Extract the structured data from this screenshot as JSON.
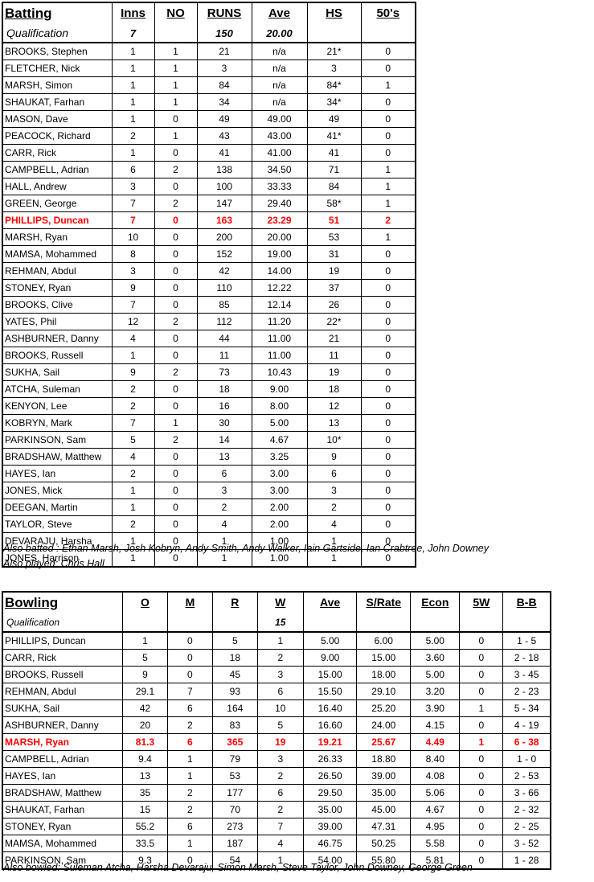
{
  "batting": {
    "title": "Batting",
    "columns": [
      "Inns",
      "NO",
      "RUNS",
      "Ave",
      "HS",
      "50's"
    ],
    "qualification_label": "Qualification",
    "qualification": [
      "7",
      "",
      "150",
      "20.00",
      "",
      ""
    ],
    "rows": [
      {
        "name": "BROOKS, Stephen",
        "inns": "1",
        "no": "1",
        "runs": "21",
        "ave": "n/a",
        "hs": "21*",
        "fifties": "0",
        "highlight": false
      },
      {
        "name": "FLETCHER, Nick",
        "inns": "1",
        "no": "1",
        "runs": "3",
        "ave": "n/a",
        "hs": "3",
        "fifties": "0",
        "highlight": false
      },
      {
        "name": "MARSH, Simon",
        "inns": "1",
        "no": "1",
        "runs": "84",
        "ave": "n/a",
        "hs": "84*",
        "fifties": "1",
        "highlight": false
      },
      {
        "name": "SHAUKAT, Farhan",
        "inns": "1",
        "no": "1",
        "runs": "34",
        "ave": "n/a",
        "hs": "34*",
        "fifties": "0",
        "highlight": false
      },
      {
        "name": "MASON, Dave",
        "inns": "1",
        "no": "0",
        "runs": "49",
        "ave": "49.00",
        "hs": "49",
        "fifties": "0",
        "highlight": false
      },
      {
        "name": "PEACOCK, Richard",
        "inns": "2",
        "no": "1",
        "runs": "43",
        "ave": "43.00",
        "hs": "41*",
        "fifties": "0",
        "highlight": false
      },
      {
        "name": "CARR, Rick",
        "inns": "1",
        "no": "0",
        "runs": "41",
        "ave": "41.00",
        "hs": "41",
        "fifties": "0",
        "highlight": false
      },
      {
        "name": "CAMPBELL, Adrian",
        "inns": "6",
        "no": "2",
        "runs": "138",
        "ave": "34.50",
        "hs": "71",
        "fifties": "1",
        "highlight": false
      },
      {
        "name": "HALL, Andrew",
        "inns": "3",
        "no": "0",
        "runs": "100",
        "ave": "33.33",
        "hs": "84",
        "fifties": "1",
        "highlight": false
      },
      {
        "name": "GREEN, George",
        "inns": "7",
        "no": "2",
        "runs": "147",
        "ave": "29.40",
        "hs": "58*",
        "fifties": "1",
        "highlight": false
      },
      {
        "name": "PHILLIPS, Duncan",
        "inns": "7",
        "no": "0",
        "runs": "163",
        "ave": "23.29",
        "hs": "51",
        "fifties": "2",
        "highlight": true
      },
      {
        "name": "MARSH, Ryan",
        "inns": "10",
        "no": "0",
        "runs": "200",
        "ave": "20.00",
        "hs": "53",
        "fifties": "1",
        "highlight": false
      },
      {
        "name": "MAMSA, Mohammed",
        "inns": "8",
        "no": "0",
        "runs": "152",
        "ave": "19.00",
        "hs": "31",
        "fifties": "0",
        "highlight": false
      },
      {
        "name": "REHMAN, Abdul",
        "inns": "3",
        "no": "0",
        "runs": "42",
        "ave": "14.00",
        "hs": "19",
        "fifties": "0",
        "highlight": false
      },
      {
        "name": "STONEY, Ryan",
        "inns": "9",
        "no": "0",
        "runs": "110",
        "ave": "12.22",
        "hs": "37",
        "fifties": "0",
        "highlight": false
      },
      {
        "name": "BROOKS, Clive",
        "inns": "7",
        "no": "0",
        "runs": "85",
        "ave": "12.14",
        "hs": "26",
        "fifties": "0",
        "highlight": false
      },
      {
        "name": "YATES, Phil",
        "inns": "12",
        "no": "2",
        "runs": "112",
        "ave": "11.20",
        "hs": "22*",
        "fifties": "0",
        "highlight": false
      },
      {
        "name": "ASHBURNER, Danny",
        "inns": "4",
        "no": "0",
        "runs": "44",
        "ave": "11.00",
        "hs": "21",
        "fifties": "0",
        "highlight": false
      },
      {
        "name": "BROOKS, Russell",
        "inns": "1",
        "no": "0",
        "runs": "11",
        "ave": "11.00",
        "hs": "11",
        "fifties": "0",
        "highlight": false
      },
      {
        "name": "SUKHA, Sail",
        "inns": "9",
        "no": "2",
        "runs": "73",
        "ave": "10.43",
        "hs": "19",
        "fifties": "0",
        "highlight": false
      },
      {
        "name": "ATCHA, Suleman",
        "inns": "2",
        "no": "0",
        "runs": "18",
        "ave": "9.00",
        "hs": "18",
        "fifties": "0",
        "highlight": false
      },
      {
        "name": "KENYON, Lee",
        "inns": "2",
        "no": "0",
        "runs": "16",
        "ave": "8.00",
        "hs": "12",
        "fifties": "0",
        "highlight": false
      },
      {
        "name": "KOBRYN, Mark",
        "inns": "7",
        "no": "1",
        "runs": "30",
        "ave": "5.00",
        "hs": "13",
        "fifties": "0",
        "highlight": false
      },
      {
        "name": "PARKINSON, Sam",
        "inns": "5",
        "no": "2",
        "runs": "14",
        "ave": "4.67",
        "hs": "10*",
        "fifties": "0",
        "highlight": false
      },
      {
        "name": "BRADSHAW, Matthew",
        "inns": "4",
        "no": "0",
        "runs": "13",
        "ave": "3.25",
        "hs": "9",
        "fifties": "0",
        "highlight": false
      },
      {
        "name": "HAYES, Ian",
        "inns": "2",
        "no": "0",
        "runs": "6",
        "ave": "3.00",
        "hs": "6",
        "fifties": "0",
        "highlight": false
      },
      {
        "name": "JONES, Mick",
        "inns": "1",
        "no": "0",
        "runs": "3",
        "ave": "3.00",
        "hs": "3",
        "fifties": "0",
        "highlight": false
      },
      {
        "name": "DEEGAN, Martin",
        "inns": "1",
        "no": "0",
        "runs": "2",
        "ave": "2.00",
        "hs": "2",
        "fifties": "0",
        "highlight": false
      },
      {
        "name": "TAYLOR, Steve",
        "inns": "2",
        "no": "0",
        "runs": "4",
        "ave": "2.00",
        "hs": "4",
        "fifties": "0",
        "highlight": false
      },
      {
        "name": "DEVARAJU, Harsha",
        "inns": "1",
        "no": "0",
        "runs": "1",
        "ave": "1.00",
        "hs": "1",
        "fifties": "0",
        "highlight": false
      },
      {
        "name": "JONES, Harrison",
        "inns": "1",
        "no": "0",
        "runs": "1",
        "ave": "1.00",
        "hs": "1",
        "fifties": "0",
        "highlight": false
      }
    ],
    "notes": [
      "Also batted : Ethan Marsh, Josh Kobryn, Andy Smith, Andy Walker, Iain Gartside, Ian Crabtree, John Downey",
      "Also played: Chris Hall"
    ]
  },
  "bowling": {
    "title": "Bowling",
    "columns": [
      "O",
      "M",
      "R",
      "W",
      "Ave",
      "S/Rate",
      "Econ",
      "5W",
      "B-B"
    ],
    "qualification_label": "Qualification",
    "qualification": [
      "",
      "",
      "",
      "15",
      "",
      "",
      "",
      "",
      ""
    ],
    "rows": [
      {
        "name": "PHILLIPS, Duncan",
        "o": "1",
        "m": "0",
        "r": "5",
        "w": "1",
        "ave": "5.00",
        "srate": "6.00",
        "econ": "5.00",
        "fivew": "0",
        "bb": "1 - 5",
        "highlight": false
      },
      {
        "name": "CARR, Rick",
        "o": "5",
        "m": "0",
        "r": "18",
        "w": "2",
        "ave": "9.00",
        "srate": "15.00",
        "econ": "3.60",
        "fivew": "0",
        "bb": "2 - 18",
        "highlight": false
      },
      {
        "name": "BROOKS, Russell",
        "o": "9",
        "m": "0",
        "r": "45",
        "w": "3",
        "ave": "15.00",
        "srate": "18.00",
        "econ": "5.00",
        "fivew": "0",
        "bb": "3 - 45",
        "highlight": false
      },
      {
        "name": "REHMAN, Abdul",
        "o": "29.1",
        "m": "7",
        "r": "93",
        "w": "6",
        "ave": "15.50",
        "srate": "29.10",
        "econ": "3.20",
        "fivew": "0",
        "bb": "2 - 23",
        "highlight": false
      },
      {
        "name": "SUKHA, Sail",
        "o": "42",
        "m": "6",
        "r": "164",
        "w": "10",
        "ave": "16.40",
        "srate": "25.20",
        "econ": "3.90",
        "fivew": "1",
        "bb": "5 - 34",
        "highlight": false
      },
      {
        "name": "ASHBURNER, Danny",
        "o": "20",
        "m": "2",
        "r": "83",
        "w": "5",
        "ave": "16.60",
        "srate": "24.00",
        "econ": "4.15",
        "fivew": "0",
        "bb": "4 - 19",
        "highlight": false
      },
      {
        "name": "MARSH, Ryan",
        "o": "81.3",
        "m": "6",
        "r": "365",
        "w": "19",
        "ave": "19.21",
        "srate": "25.67",
        "econ": "4.49",
        "fivew": "1",
        "bb": "6 - 38",
        "highlight": true
      },
      {
        "name": "CAMPBELL, Adrian",
        "o": "9.4",
        "m": "1",
        "r": "79",
        "w": "3",
        "ave": "26.33",
        "srate": "18.80",
        "econ": "8.40",
        "fivew": "0",
        "bb": "1 - 0",
        "highlight": false
      },
      {
        "name": "HAYES, Ian",
        "o": "13",
        "m": "1",
        "r": "53",
        "w": "2",
        "ave": "26.50",
        "srate": "39.00",
        "econ": "4.08",
        "fivew": "0",
        "bb": "2 - 53",
        "highlight": false
      },
      {
        "name": "BRADSHAW, Matthew",
        "o": "35",
        "m": "2",
        "r": "177",
        "w": "6",
        "ave": "29.50",
        "srate": "35.00",
        "econ": "5.06",
        "fivew": "0",
        "bb": "3 - 66",
        "highlight": false
      },
      {
        "name": "SHAUKAT, Farhan",
        "o": "15",
        "m": "2",
        "r": "70",
        "w": "2",
        "ave": "35.00",
        "srate": "45.00",
        "econ": "4.67",
        "fivew": "0",
        "bb": "2 - 32",
        "highlight": false
      },
      {
        "name": "STONEY, Ryan",
        "o": "55.2",
        "m": "6",
        "r": "273",
        "w": "7",
        "ave": "39.00",
        "srate": "47.31",
        "econ": "4.95",
        "fivew": "0",
        "bb": "2 - 25",
        "highlight": false
      },
      {
        "name": "MAMSA, Mohammed",
        "o": "33.5",
        "m": "1",
        "r": "187",
        "w": "4",
        "ave": "46.75",
        "srate": "50.25",
        "econ": "5.58",
        "fivew": "0",
        "bb": "3 - 52",
        "highlight": false
      },
      {
        "name": "PARKINSON, Sam",
        "o": "9.3",
        "m": "0",
        "r": "54",
        "w": "1",
        "ave": "54.00",
        "srate": "55.80",
        "econ": "5.81",
        "fivew": "0",
        "bb": "1 - 28",
        "highlight": false
      }
    ],
    "notes": [
      "Also bowled: Suleman Atcha, Harsha Devaraju, Simon Marsh, Steve Taylor, John Downey, George Green"
    ]
  },
  "colors": {
    "highlight": "#FF0000",
    "text": "#000000",
    "background": "#FFFFFF",
    "rule": "#000000"
  }
}
